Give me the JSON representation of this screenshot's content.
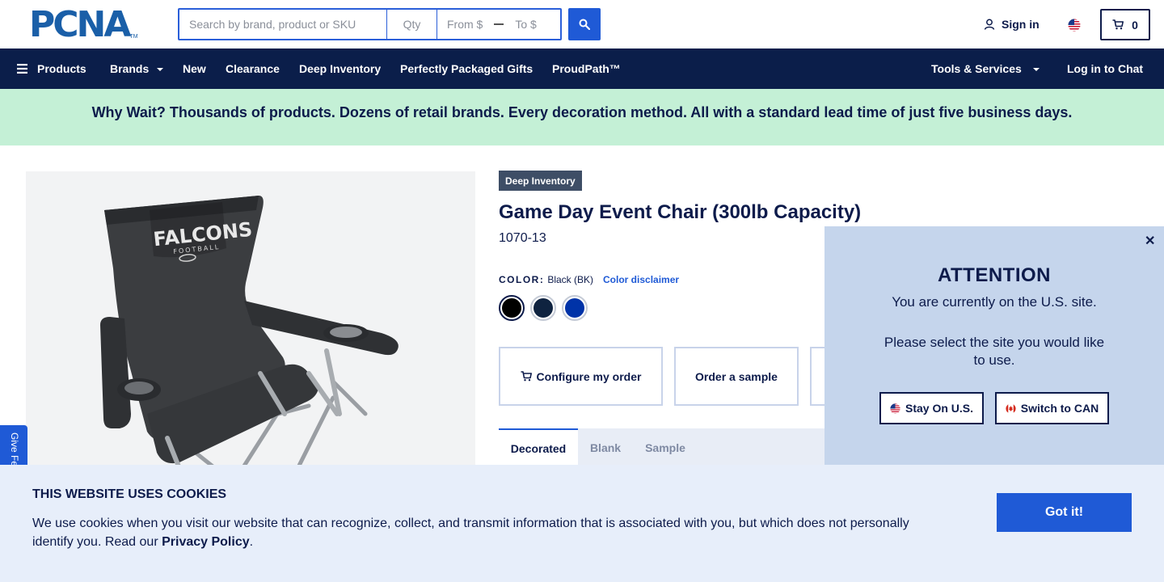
{
  "header": {
    "logo": "PCNA",
    "logo_tm": "TM",
    "search_placeholder": "Search by brand, product or SKU",
    "qty_placeholder": "Qty",
    "price_from_placeholder": "From $",
    "price_to_placeholder": "To $",
    "sign_in": "Sign in",
    "cart_count": "0"
  },
  "nav": {
    "products": "Products",
    "brands": "Brands",
    "new": "New",
    "clearance": "Clearance",
    "deep_inventory": "Deep Inventory",
    "gifts": "Perfectly Packaged Gifts",
    "proudpath": "ProudPath™",
    "tools": "Tools & Services",
    "chat": "Log in to Chat"
  },
  "banner": {
    "text": "Why Wait? Thousands of products. Dozens of retail brands. Every decoration method. All with a standard lead time of just five business days."
  },
  "product": {
    "badge": "Deep Inventory",
    "title": "Game Day Event Chair (300lb Capacity)",
    "sku": "1070-13",
    "color_label": "COLOR:",
    "color_value": "Black (BK)",
    "color_disclaimer": "Color disclaimer",
    "print_text": "FALCONS",
    "print_subtext": "FOOTBALL",
    "swatches": [
      {
        "name": "Black",
        "color": "#000000"
      },
      {
        "name": "Navy",
        "color": "#0f2340"
      },
      {
        "name": "Royal",
        "color": "#0033a8"
      }
    ],
    "actions": {
      "configure": "Configure my order",
      "sample": "Order a sample"
    },
    "tabs": [
      "Decorated",
      "Blank",
      "Sample"
    ]
  },
  "feedback": {
    "label": "Give Feedback"
  },
  "region_popup": {
    "heading": "ATTENTION",
    "message": "You are currently on the U.S. site.",
    "prompt": "Please select the site you would like to use.",
    "stay": "Stay On U.S.",
    "switch": "Switch to CAN"
  },
  "cookie": {
    "title": "THIS WEBSITE USES COOKIES",
    "text": "We use cookies when you visit our website that can recognize, collect, and transmit information that is associated with you, but which does not personally identify you. Read our ",
    "link": "Privacy Policy",
    "period": ".",
    "button": "Got it!"
  },
  "colors": {
    "navy": "#0b1e4a",
    "brand_blue": "#1f5ad6",
    "banner_green": "#c4f0d6",
    "popup_bg": "#c5d5ec",
    "cookie_bg": "#e7eefa"
  }
}
